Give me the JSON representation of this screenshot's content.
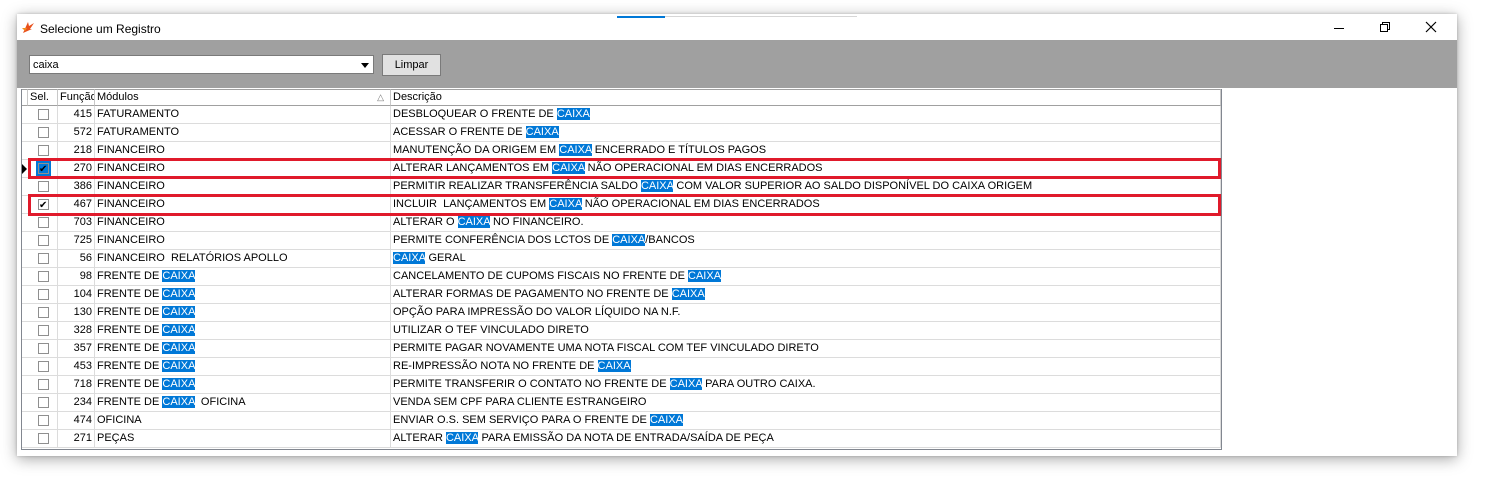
{
  "window": {
    "title": "Selecione um Registro",
    "icon": "app-logo-icon",
    "controls": [
      "minimize-icon",
      "restore-icon",
      "close-icon"
    ]
  },
  "toolbar": {
    "search_value": "caixa",
    "clear_label": "Limpar"
  },
  "grid": {
    "columns": [
      "Sel.",
      "Função",
      "Módulos",
      "Descrição"
    ],
    "rows": [
      {
        "sel": false,
        "fn": "415",
        "mod": [
          [
            "FATURAMENTO",
            false
          ]
        ],
        "desc": [
          [
            "DESBLOQUEAR O FRENTE DE ",
            false
          ],
          [
            "CAIXA",
            true
          ]
        ]
      },
      {
        "sel": false,
        "fn": "572",
        "mod": [
          [
            "FATURAMENTO",
            false
          ]
        ],
        "desc": [
          [
            "ACESSAR O FRENTE DE ",
            false
          ],
          [
            "CAIXA",
            true
          ]
        ]
      },
      {
        "sel": false,
        "fn": "218",
        "mod": [
          [
            "FINANCEIRO",
            false
          ]
        ],
        "desc": [
          [
            "MANUTENÇÃO DA ORIGEM EM ",
            false
          ],
          [
            "CAIXA",
            true
          ],
          [
            " ENCERRADO E TÍTULOS PAGOS",
            false
          ]
        ]
      },
      {
        "sel": true,
        "current": true,
        "fn": "270",
        "mod": [
          [
            "FINANCEIRO",
            false
          ]
        ],
        "desc": [
          [
            "ALTERAR LANÇAMENTOS EM ",
            false
          ],
          [
            "CAIXA",
            true
          ],
          [
            " NÃO OPERACIONAL EM DIAS ENCERRADOS",
            false
          ]
        ]
      },
      {
        "sel": false,
        "fn": "386",
        "mod": [
          [
            "FINANCEIRO",
            false
          ]
        ],
        "desc": [
          [
            "PERMITIR REALIZAR TRANSFERÊNCIA SALDO ",
            false
          ],
          [
            "CAIXA",
            true
          ],
          [
            " COM VALOR SUPERIOR AO SALDO DISPONÍVEL DO CAIXA ORIGEM",
            false
          ]
        ]
      },
      {
        "sel": true,
        "fn": "467",
        "mod": [
          [
            "FINANCEIRO",
            false
          ]
        ],
        "desc": [
          [
            "INCLUIR  LANÇAMENTOS EM ",
            false
          ],
          [
            "CAIXA",
            true
          ],
          [
            " NÃO OPERACIONAL EM DIAS ENCERRADOS",
            false
          ]
        ]
      },
      {
        "sel": false,
        "fn": "703",
        "mod": [
          [
            "FINANCEIRO",
            false
          ]
        ],
        "desc": [
          [
            "ALTERAR O ",
            false
          ],
          [
            "CAIXA",
            true
          ],
          [
            " NO FINANCEIRO.",
            false
          ]
        ]
      },
      {
        "sel": false,
        "fn": "725",
        "mod": [
          [
            "FINANCEIRO",
            false
          ]
        ],
        "desc": [
          [
            "PERMITE CONFERÊNCIA DOS LCTOS DE ",
            false
          ],
          [
            "CAIXA",
            true
          ],
          [
            "/BANCOS",
            false
          ]
        ]
      },
      {
        "sel": false,
        "fn": "56",
        "mod": [
          [
            "FINANCEIRO  RELATÓRIOS APOLLO",
            false
          ]
        ],
        "desc": [
          [
            "CAIXA",
            true
          ],
          [
            " GERAL",
            false
          ]
        ]
      },
      {
        "sel": false,
        "fn": "98",
        "mod": [
          [
            "FRENTE DE ",
            false
          ],
          [
            "CAIXA",
            true
          ]
        ],
        "desc": [
          [
            "CANCELAMENTO DE CUPOMS FISCAIS NO FRENTE DE ",
            false
          ],
          [
            "CAIXA",
            true
          ]
        ]
      },
      {
        "sel": false,
        "fn": "104",
        "mod": [
          [
            "FRENTE DE ",
            false
          ],
          [
            "CAIXA",
            true
          ]
        ],
        "desc": [
          [
            "ALTERAR FORMAS DE PAGAMENTO NO FRENTE DE ",
            false
          ],
          [
            "CAIXA",
            true
          ]
        ]
      },
      {
        "sel": false,
        "fn": "130",
        "mod": [
          [
            "FRENTE DE ",
            false
          ],
          [
            "CAIXA",
            true
          ]
        ],
        "desc": [
          [
            "OPÇÃO PARA IMPRESSÃO DO VALOR LÍQUIDO NA N.F.",
            false
          ]
        ]
      },
      {
        "sel": false,
        "fn": "328",
        "mod": [
          [
            "FRENTE DE ",
            false
          ],
          [
            "CAIXA",
            true
          ]
        ],
        "desc": [
          [
            "UTILIZAR O TEF VINCULADO DIRETO",
            false
          ]
        ]
      },
      {
        "sel": false,
        "fn": "357",
        "mod": [
          [
            "FRENTE DE ",
            false
          ],
          [
            "CAIXA",
            true
          ]
        ],
        "desc": [
          [
            "PERMITE PAGAR NOVAMENTE UMA NOTA FISCAL COM TEF VINCULADO DIRETO",
            false
          ]
        ]
      },
      {
        "sel": false,
        "fn": "453",
        "mod": [
          [
            "FRENTE DE ",
            false
          ],
          [
            "CAIXA",
            true
          ]
        ],
        "desc": [
          [
            "RE-IMPRESSÃO NOTA NO FRENTE DE ",
            false
          ],
          [
            "CAIXA",
            true
          ]
        ]
      },
      {
        "sel": false,
        "fn": "718",
        "mod": [
          [
            "FRENTE DE ",
            false
          ],
          [
            "CAIXA",
            true
          ]
        ],
        "desc": [
          [
            "PERMITE TRANSFERIR O CONTATO NO FRENTE DE ",
            false
          ],
          [
            "CAIXA",
            true
          ],
          [
            " PARA OUTRO CAIXA.",
            false
          ]
        ]
      },
      {
        "sel": false,
        "fn": "234",
        "mod": [
          [
            "FRENTE DE ",
            false
          ],
          [
            "CAIXA",
            true
          ],
          [
            "  OFICINA",
            false
          ]
        ],
        "desc": [
          [
            "VENDA SEM CPF PARA CLIENTE ESTRANGEIRO",
            false
          ]
        ]
      },
      {
        "sel": false,
        "fn": "474",
        "mod": [
          [
            "OFICINA",
            false
          ]
        ],
        "desc": [
          [
            "ENVIAR O.S. SEM SERVIÇO PARA O FRENTE DE ",
            false
          ],
          [
            "CAIXA",
            true
          ]
        ]
      },
      {
        "sel": false,
        "fn": "271",
        "mod": [
          [
            "PEÇAS",
            false
          ]
        ],
        "desc": [
          [
            "ALTERAR ",
            false
          ],
          [
            "CAIXA",
            true
          ],
          [
            " PARA EMISSÃO DA NOTA DE ENTRADA/SAÍDA DE PEÇA",
            false
          ]
        ]
      }
    ]
  },
  "colors": {
    "highlight": "#0078d7",
    "annotation": "#e01a2b",
    "toolbar_bg": "#a0a0a0"
  }
}
